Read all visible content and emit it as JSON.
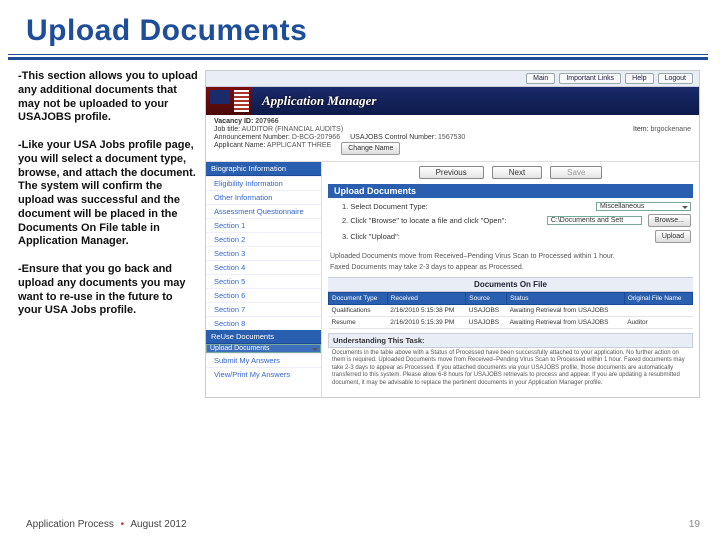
{
  "title": "Upload Documents",
  "left": {
    "p1": "-This section allows you to upload any additional documents that may not be uploaded to your USAJOBS profile.",
    "p2": "-Like your USA Jobs profile page, you will select a document type, browse, and attach the document. The system will confirm the upload was successful and the document will be placed in the Documents On File table in Application Manager.",
    "p3": "-Ensure that you go back and upload any documents you may want to re-use in the future to your USA Jobs profile."
  },
  "app": {
    "banner_title": "Application Manager",
    "top_buttons": [
      "Main",
      "Important Links",
      "Help",
      "Logout"
    ],
    "info": {
      "vacancy_label": "Vacancy ID:",
      "vacancy_value": "207966",
      "job_label": "Job title:",
      "job_value": "AUDITOR (FINANCIAL AUDITS)",
      "ann_label": "Announcement Number:",
      "ann_value": "D-BCG-207966",
      "usj_label": "USAJOBS Control Number:",
      "usj_value": "1567530",
      "applicant_label": "Applicant Name:",
      "applicant_value": "APPLICANT THREE",
      "change_name_btn": "Change Name",
      "item_label": "Item:",
      "item_value": "brgockenane"
    },
    "sidebar": {
      "h1": "Biographic Information",
      "items1": [
        "Eligibility Information",
        "Other Information",
        "Assessment Questionnaire"
      ],
      "sections": [
        "Section 1",
        "Section 2",
        "Section 3",
        "Section 4",
        "Section 5",
        "Section 6",
        "Section 7",
        "Section 8"
      ],
      "h2": "ReUse Documents",
      "sel": "Upload Documents",
      "items3": [
        "Submit My Answers",
        "View/Print My Answers"
      ]
    },
    "buttons": {
      "prev": "Previous",
      "next": "Next",
      "save": "Save"
    },
    "panel_title": "Upload Documents",
    "form": {
      "step1": "1. Select Document Type:",
      "doc_type_value": "Miscellaneous",
      "step2": "2. Click \"Browse\" to locate a file and click \"Open\":",
      "file_value": "C:\\Documents and Sett",
      "browse_btn": "Browse...",
      "step3": "3. Click \"Upload\":",
      "upload_btn": "Upload"
    },
    "notes": {
      "n1": "Uploaded Documents move from Received–Pending Virus Scan to Processed within 1 hour.",
      "n2": "Faxed Documents may take 2-3 days to appear as Processed."
    },
    "docs_header": "Documents On File",
    "table": {
      "cols": [
        "Document Type",
        "Received",
        "Source",
        "Status",
        "Original File Name"
      ],
      "rows": [
        {
          "type": "Qualifications",
          "received": "2/16/2010 5:15:38 PM",
          "source": "USAJOBS",
          "status": "Awaiting Retrieval from USAJOBS",
          "file": ""
        },
        {
          "type": "Resume",
          "received": "2/16/2010 5:15:39 PM",
          "source": "USAJOBS",
          "status": "Awaiting Retrieval from USAJOBS",
          "file": "Auditor"
        }
      ]
    },
    "ut_title": "Understanding This Task:",
    "ut_body": "Documents in the table above with a Status of Processed have been successfully attached to your application. No further action on them is required. Uploaded Documents move from Received–Pending Virus Scan to Processed within 1 hour. Faxed documents may take 2-3 days to appear as Processed. If you attached documents via your USAJOBS profile, those documents are automatically transferred to this system. Please allow 6-8 hours for USAJOBS retrievals to process and appear. If you are updating a resubmitted document, it may be advisable to replace the pertinent documents in your Application Manager profile."
  },
  "footer": {
    "left1": "Application Process",
    "dot": "•",
    "left2": "August 2012",
    "page": "19"
  }
}
